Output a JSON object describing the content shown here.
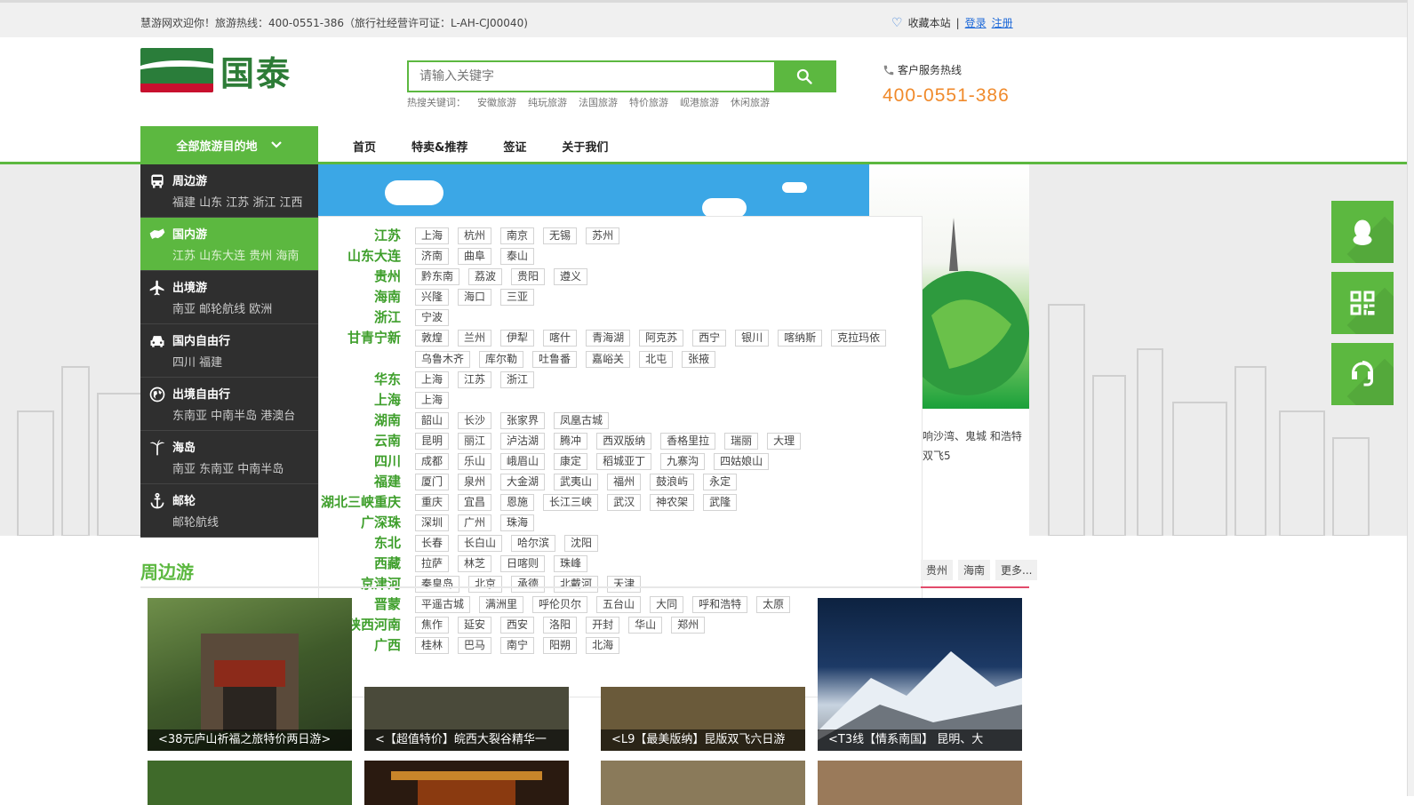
{
  "topbar": {
    "welcome": "慧游网欢迎你！旅游热线：400-0551-386（旅行社经营许可证：L-AH-CJ00040)",
    "favorite": "收藏本站",
    "separator": "|",
    "login": "登录",
    "register": "注册"
  },
  "logo": {
    "name": "国泰"
  },
  "search": {
    "placeholder": "请输入关键字",
    "hot_label": "热搜关键词：",
    "hot_words": [
      "安徽旅游",
      "纯玩旅游",
      "法国旅游",
      "特价旅游",
      "岘港旅游",
      "休闲旅游"
    ]
  },
  "hotline": {
    "label": "客户服务热线",
    "number": "400-0551-386"
  },
  "nav": {
    "all_destinations": "全部旅游目的地",
    "items": [
      "首页",
      "特卖&推荐",
      "签证",
      "关于我们"
    ]
  },
  "categories": [
    {
      "title": "周边游",
      "sub": "福建 山东 江苏 浙江 江西",
      "icon": "bus-icon"
    },
    {
      "title": "国内游",
      "sub": "江苏 山东大连 贵州 海南",
      "icon": "china-map-icon"
    },
    {
      "title": "出境游",
      "sub": "南亚 邮轮航线 欧洲",
      "icon": "plane-icon"
    },
    {
      "title": "国内自由行",
      "sub": "四川 福建",
      "icon": "car-icon"
    },
    {
      "title": "出境自由行",
      "sub": "东南亚 中南半岛 港澳台",
      "icon": "globe-icon"
    },
    {
      "title": "海岛",
      "sub": "南亚 东南亚 中南半岛",
      "icon": "palm-tree-icon"
    },
    {
      "title": "邮轮",
      "sub": "邮轮航线",
      "icon": "anchor-icon"
    }
  ],
  "destinations": [
    {
      "region": "江苏",
      "cities": [
        "上海",
        "杭州",
        "南京",
        "无锡",
        "苏州"
      ]
    },
    {
      "region": "山东大连",
      "cities": [
        "济南",
        "曲阜",
        "泰山"
      ]
    },
    {
      "region": "贵州",
      "cities": [
        "黔东南",
        "荔波",
        "贵阳",
        "遵义"
      ]
    },
    {
      "region": "海南",
      "cities": [
        "兴隆",
        "海口",
        "三亚"
      ]
    },
    {
      "region": "浙江",
      "cities": [
        "宁波"
      ]
    },
    {
      "region": "甘青宁新",
      "cities": [
        "敦煌",
        "兰州",
        "伊犁",
        "喀什",
        "青海湖",
        "阿克苏",
        "西宁",
        "银川",
        "喀纳斯",
        "克拉玛依",
        "乌鲁木齐",
        "库尔勒",
        "吐鲁番",
        "嘉峪关",
        "北屯",
        "张掖"
      ]
    },
    {
      "region": "华东",
      "cities": [
        "上海",
        "江苏",
        "浙江"
      ]
    },
    {
      "region": "上海",
      "cities": [
        "上海"
      ]
    },
    {
      "region": "湖南",
      "cities": [
        "韶山",
        "长沙",
        "张家界",
        "凤凰古城"
      ]
    },
    {
      "region": "云南",
      "cities": [
        "昆明",
        "丽江",
        "泸沽湖",
        "腾冲",
        "西双版纳",
        "香格里拉",
        "瑞丽",
        "大理"
      ]
    },
    {
      "region": "四川",
      "cities": [
        "成都",
        "乐山",
        "峨眉山",
        "康定",
        "稻城亚丁",
        "九寨沟",
        "四姑娘山"
      ]
    },
    {
      "region": "福建",
      "cities": [
        "厦门",
        "泉州",
        "大金湖",
        "武夷山",
        "福州",
        "鼓浪屿",
        "永定"
      ]
    },
    {
      "region": "湖北三峡重庆",
      "cities": [
        "重庆",
        "宜昌",
        "恩施",
        "长江三峡",
        "武汉",
        "神农架",
        "武隆"
      ]
    },
    {
      "region": "广深珠",
      "cities": [
        "深圳",
        "广州",
        "珠海"
      ]
    },
    {
      "region": "东北",
      "cities": [
        "长春",
        "长白山",
        "哈尔滨",
        "沈阳"
      ]
    },
    {
      "region": "西藏",
      "cities": [
        "拉萨",
        "林芝",
        "日喀则",
        "珠峰"
      ]
    },
    {
      "region": "京津河",
      "cities": [
        "秦皇岛",
        "北京",
        "承德",
        "北戴河",
        "天津"
      ]
    },
    {
      "region": "晋蒙",
      "cities": [
        "平遥古城",
        "满洲里",
        "呼伦贝尔",
        "五台山",
        "大同",
        "呼和浩特",
        "太原"
      ]
    },
    {
      "region": "陕西河南",
      "cities": [
        "焦作",
        "延安",
        "西安",
        "洛阳",
        "开封",
        "华山",
        "郑州"
      ]
    },
    {
      "region": "广西",
      "cities": [
        "桂林",
        "巴马",
        "南宁",
        "阳朔",
        "北海"
      ]
    }
  ],
  "banner": {
    "text_fragment": "响沙湾、鬼城 和浩特双飞5"
  },
  "section": {
    "title": "周边游",
    "tabs": [
      "贵州",
      "海南",
      "更多..."
    ],
    "cards": [
      "<38元庐山祈福之旅特价两日游>",
      "<【超值特价】皖西大裂谷精华一",
      "<L9【最美版纳】昆版双飞六日游",
      "<T3线【情系南国】 昆明、大"
    ]
  },
  "colors": {
    "brand_green": "#5cb840",
    "dark_menu": "#2f2f2f",
    "hotline_orange": "#f08a2b"
  }
}
